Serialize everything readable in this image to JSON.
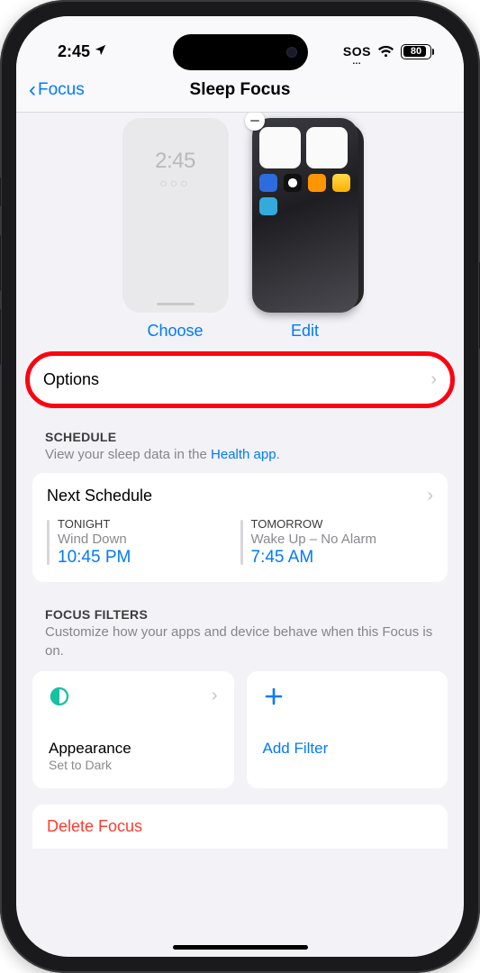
{
  "status": {
    "time": "2:45",
    "sos": "SOS",
    "battery": "80"
  },
  "nav": {
    "back": "Focus",
    "title": "Sleep Focus"
  },
  "previews": {
    "lock_time": "2:45",
    "lock_dots": "○○○",
    "choose": "Choose",
    "edit": "Edit"
  },
  "options": {
    "label": "Options"
  },
  "schedule": {
    "title": "SCHEDULE",
    "subtitle_prefix": "View your sleep data in the ",
    "subtitle_link": "Health app",
    "subtitle_suffix": ".",
    "card_title": "Next Schedule",
    "tonight": {
      "label": "TONIGHT",
      "desc": "Wind Down",
      "time": "10:45 PM"
    },
    "tomorrow": {
      "label": "TOMORROW",
      "desc": "Wake Up – No Alarm",
      "time": "7:45 AM"
    }
  },
  "filters": {
    "title": "FOCUS FILTERS",
    "subtitle": "Customize how your apps and device behave when this Focus is on.",
    "appearance": {
      "label": "Appearance",
      "sub": "Set to Dark"
    },
    "add": "Add Filter"
  },
  "delete": {
    "label": "Delete Focus"
  },
  "colors": {
    "accent": "#007aff",
    "destructive": "#ff3b30",
    "highlight": "#ff0012",
    "appearance_icon": "#17c1a3"
  }
}
